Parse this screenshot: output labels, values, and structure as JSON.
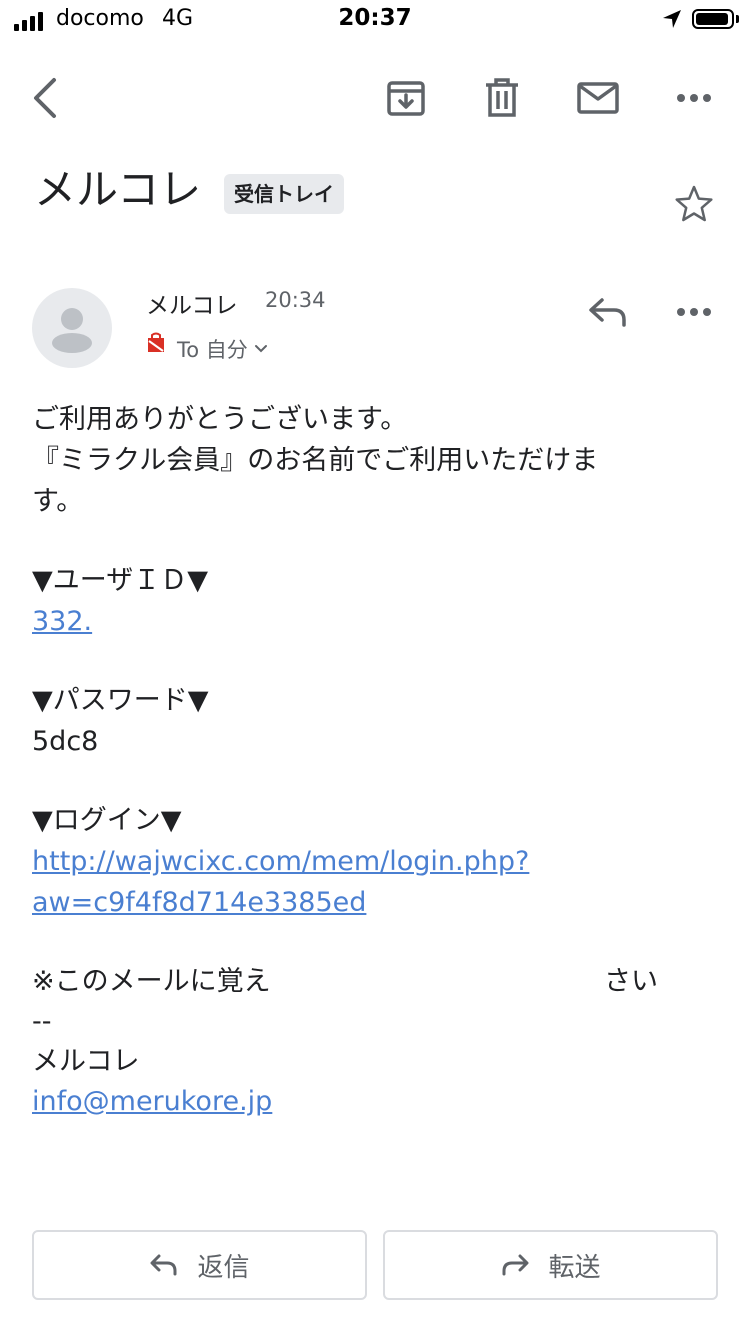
{
  "status_bar": {
    "carrier": "docomo",
    "network": "4G",
    "time": "20:37"
  },
  "toolbar": {
    "icons": [
      "back-icon",
      "archive-icon",
      "trash-icon",
      "mail-icon",
      "more-icon"
    ]
  },
  "email": {
    "subject": "メルコレ",
    "label": "受信トレイ",
    "sender": "メルコレ",
    "time": "20:34",
    "recipient": "To 自分",
    "body": {
      "line1": "ご利用ありがとうございます。",
      "line2": "『ミラクル会員』のお名前でご利用いただけま",
      "line3": "す。",
      "user_id_heading": "▼ユーザＩＤ▼",
      "user_id": "332.",
      "password_heading": "▼パスワード▼",
      "password": "5dc8",
      "login_heading": "▼ログイン▼",
      "login_url_line1": "http://wajwcixc.com/mem/login.php?",
      "login_url_line2": "aw=c9f4f8d714e3385ed",
      "notice_start": "※このメールに覚え",
      "notice_end": "さい",
      "separator": "--",
      "signature_name": "メルコレ",
      "signature_email": "info@merukore.jp"
    }
  },
  "actions": {
    "reply_label": "返信",
    "forward_label": "転送"
  },
  "colors": {
    "link": "#4a7fd1",
    "icon": "#5f6368",
    "chip": "#e8eaed",
    "important_tag": "#d93025"
  }
}
